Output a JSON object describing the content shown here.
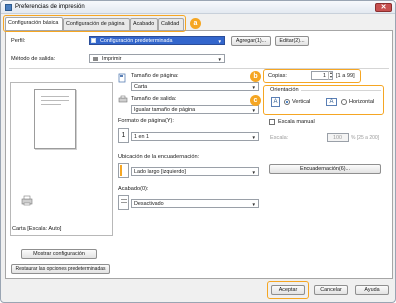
{
  "window": {
    "title": "Preferencias de impresión",
    "close_glyph": "✕"
  },
  "tabs": [
    {
      "label": "Configuración básica"
    },
    {
      "label": "Configuración de página"
    },
    {
      "label": "Acabado"
    },
    {
      "label": "Calidad"
    }
  ],
  "callouts": {
    "a": "a",
    "b": "b",
    "c": "c"
  },
  "profile": {
    "label": "Perfil:",
    "value": "Configuración predeterminada",
    "add_button": "Agregar(1)...",
    "edit_button": "Editar(2)..."
  },
  "output_method": {
    "label": "Método de salida:",
    "value": "Imprimir"
  },
  "preview": {
    "caption": "Carta [Escala: Auto]",
    "show_settings_button": "Mostrar configuración",
    "restore_defaults_button": "Restaurar las opciones predeterminadas"
  },
  "page_size": {
    "label": "Tamaño de página:",
    "value": "Carta"
  },
  "output_size": {
    "label": "Tamaño de salida:",
    "value": "Igualar tamaño de página"
  },
  "copies": {
    "label": "Copias:",
    "value": "1",
    "range": "[1 a 99]"
  },
  "orientation": {
    "label": "Orientación",
    "options": [
      {
        "label": "Vertical",
        "selected": true
      },
      {
        "label": "Horizontal",
        "selected": false
      }
    ],
    "icon_glyph": "A"
  },
  "page_layout": {
    "label": "Formato de página(Y):",
    "icon_value": "1",
    "value": "1 en 1"
  },
  "manual_scaling": {
    "label": "Escala manual",
    "checked": false,
    "scale_label": "Escala:",
    "scale_value": "100",
    "scale_range": "% [25 a 200]"
  },
  "binding_location": {
    "label": "Ubicación de la encuadernación:",
    "value": "Lado largo [izquierdo]",
    "button": "Encuadernación(6)..."
  },
  "finishing": {
    "label": "Acabado(0):",
    "value": "Desactivado"
  },
  "footer": {
    "ok_button": "Aceptar",
    "cancel_button": "Cancelar",
    "help_button": "Ayuda"
  },
  "colors": {
    "accent": "#f5a623",
    "selection": "#3366cc"
  }
}
